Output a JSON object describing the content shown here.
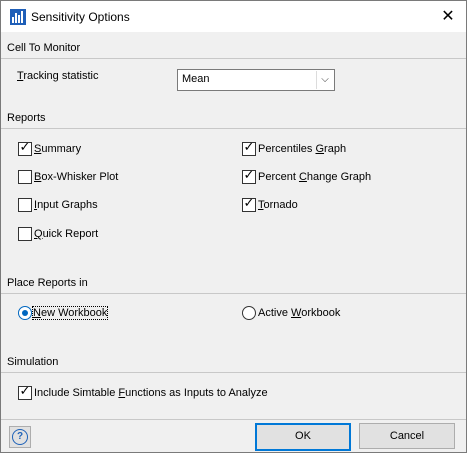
{
  "window": {
    "title": "Sensitivity Options",
    "close_glyph": "✕"
  },
  "sections": {
    "cell_to_monitor": "Cell To Monitor",
    "reports": "Reports",
    "place_reports": "Place Reports in",
    "simulation": "Simulation"
  },
  "tracking": {
    "label_first": "T",
    "label_rest": "racking statistic",
    "value": "Mean",
    "arrow": "⌵"
  },
  "reports": {
    "summary": {
      "u": "S",
      "rest": "ummary",
      "checked": true
    },
    "box_whisker": {
      "u": "B",
      "rest": "ox-Whisker Plot",
      "checked": false
    },
    "input_graphs": {
      "u": "I",
      "rest": "nput Graphs",
      "checked": false
    },
    "quick_report": {
      "u": "Q",
      "rest": "uick Report",
      "checked": false
    },
    "percentiles_graph": {
      "pre": "Percentiles ",
      "u": "G",
      "rest": "raph",
      "checked": true
    },
    "percent_change_graph": {
      "pre": "Percent ",
      "u": "C",
      "rest": "hange Graph",
      "checked": true
    },
    "tornado": {
      "u": "T",
      "rest": "ornado",
      "checked": true
    }
  },
  "place": {
    "new_workbook": {
      "u": "N",
      "rest": "ew Workbook",
      "selected": true
    },
    "active_workbook": {
      "pre": "Active ",
      "u": "W",
      "rest": "orkbook",
      "selected": false
    }
  },
  "simulation": {
    "pre": "Include Simtable ",
    "u": "F",
    "rest": "unctions as Inputs to Analyze",
    "checked": true
  },
  "buttons": {
    "ok": "OK",
    "cancel": "Cancel",
    "help_glyph": "?"
  },
  "check_glyph": "✓",
  "colors": {
    "accent": "#0078d7",
    "title_icon": "#1f5fb8"
  }
}
